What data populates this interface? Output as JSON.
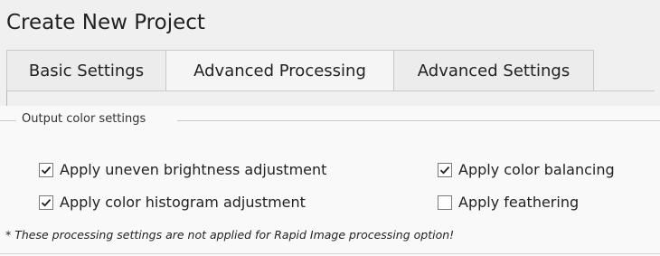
{
  "window": {
    "title": "Create New Project"
  },
  "tabs": [
    {
      "label": "Basic Settings",
      "active": false
    },
    {
      "label": "Advanced Processing",
      "active": true
    },
    {
      "label": "Advanced Settings",
      "active": false
    }
  ],
  "group": {
    "title": "Output color settings",
    "checkboxes": [
      {
        "label": "Apply uneven brightness adjustment",
        "checked": true
      },
      {
        "label": "Apply color balancing",
        "checked": true
      },
      {
        "label": "Apply color histogram adjustment",
        "checked": true
      },
      {
        "label": "Apply feathering",
        "checked": false
      }
    ]
  },
  "note": "* These processing settings are not applied for Rapid Image processing option!"
}
